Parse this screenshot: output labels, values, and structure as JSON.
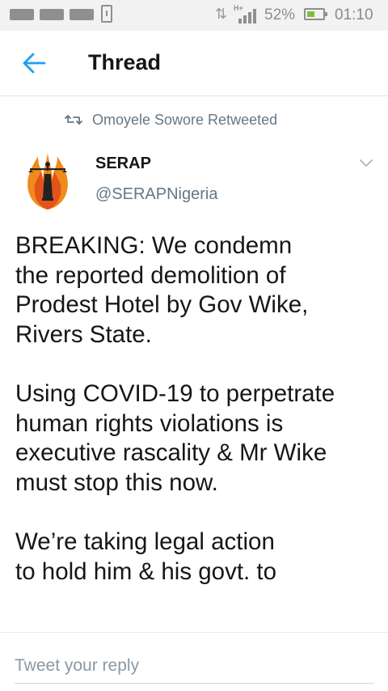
{
  "status_bar": {
    "battery_percent": "52%",
    "battery_level": 0.52,
    "time": "01:10",
    "network_type": "H+",
    "data_icon": "data-transfer-icon",
    "notification_count": 3
  },
  "header": {
    "back_icon": "back-arrow-icon",
    "title": "Thread"
  },
  "tweet": {
    "retweet_icon": "retweet-icon",
    "retweeted_by": "Omoyele Sowore Retweeted",
    "author": {
      "name": "SERAP",
      "handle": "@SERAPNigeria",
      "avatar_icon": "serap-logo-avatar"
    },
    "menu_icon": "chevron-down-icon",
    "paragraphs": [
      "BREAKING: We condemn\nthe reported demolition of\nProdest Hotel by Gov Wike,\nRivers State.",
      "Using COVID-19 to perpetrate\nhuman rights violations is\nexecutive rascality & Mr Wike\nmust stop this now.",
      "We’re taking legal action\nto hold him & his govt. to"
    ]
  },
  "reply": {
    "placeholder": "Tweet your reply",
    "value": ""
  },
  "colors": {
    "accent": "#1da1f2",
    "text_primary": "#14171a",
    "text_secondary": "#657786",
    "status_bar_bg": "#f2f2f2",
    "battery_fill": "#7fbf3f"
  }
}
